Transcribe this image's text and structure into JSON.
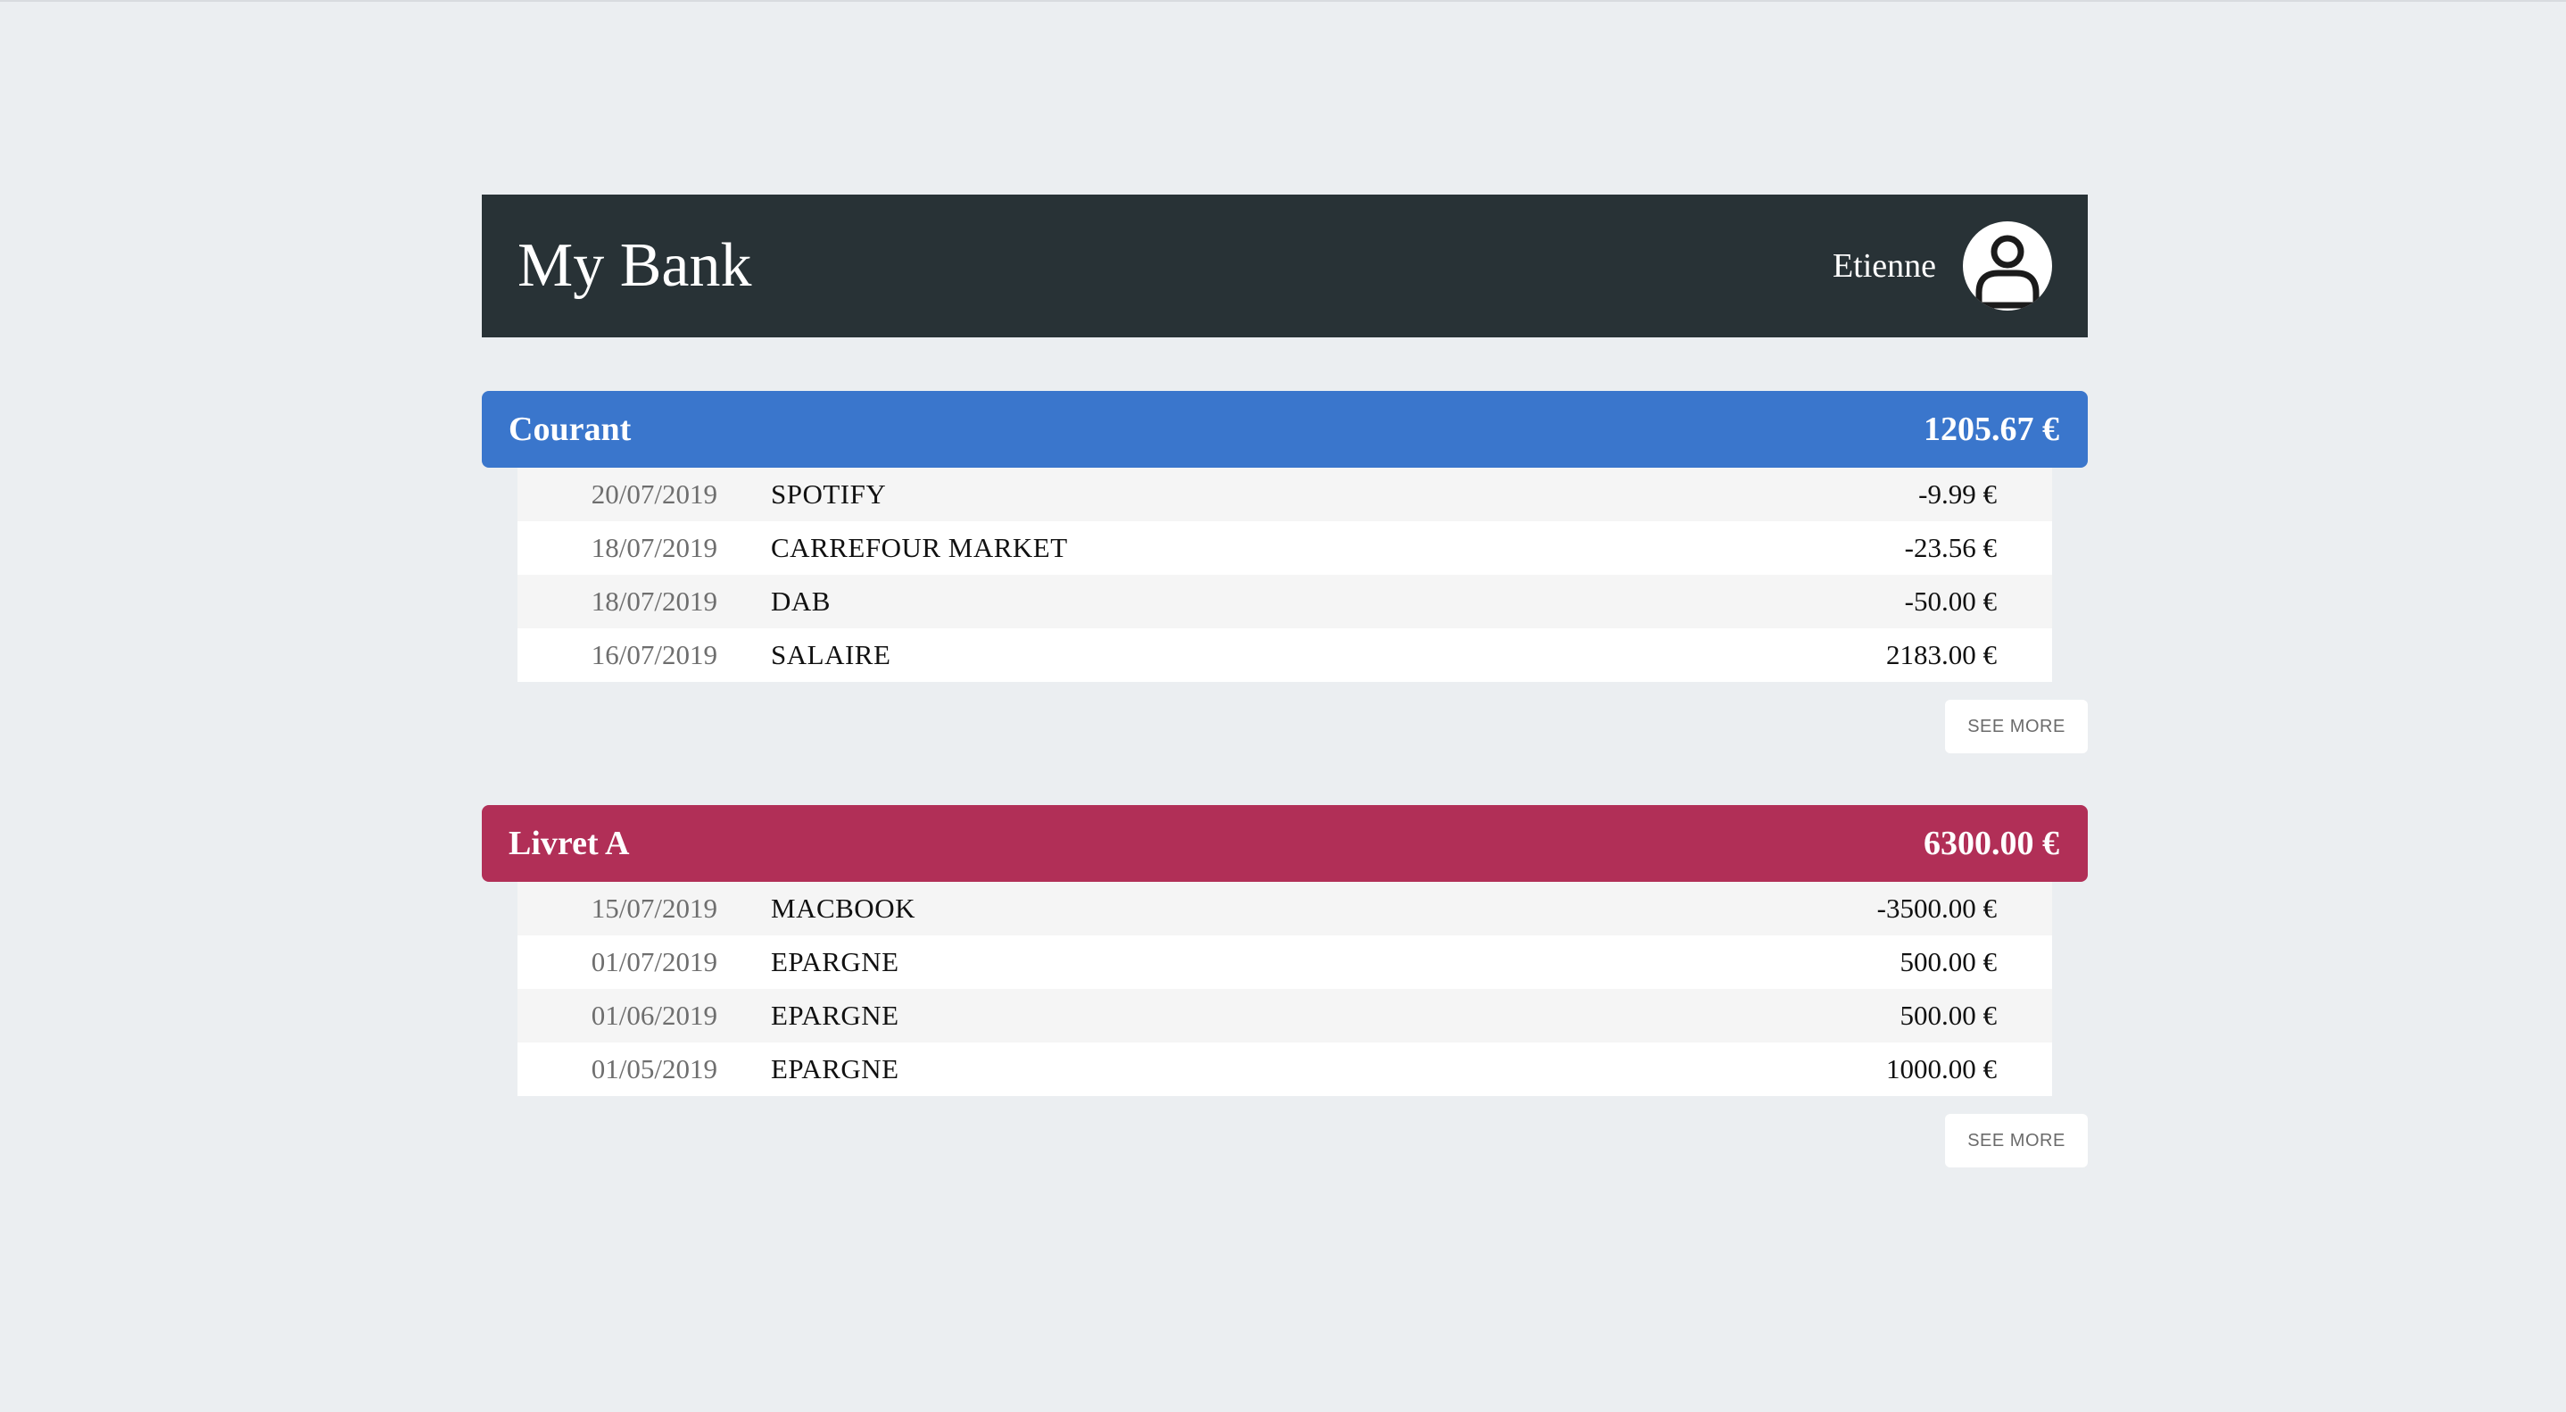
{
  "app": {
    "title": "My Bank"
  },
  "user": {
    "name": "Etienne",
    "avatar_icon": "user-avatar-icon"
  },
  "colors": {
    "header_bg": "#283236",
    "background": "#ebeef1",
    "courant_accent": "#3a76cc",
    "livret_accent": "#b12f57"
  },
  "accounts": [
    {
      "name": "Courant",
      "balance": "1205.67 €",
      "color": "#3a76cc",
      "transactions": [
        {
          "date": "20/07/2019",
          "label": "SPOTIFY",
          "amount": "-9.99 €"
        },
        {
          "date": "18/07/2019",
          "label": "CARREFOUR MARKET",
          "amount": "-23.56 €"
        },
        {
          "date": "18/07/2019",
          "label": "DAB",
          "amount": "-50.00 €"
        },
        {
          "date": "16/07/2019",
          "label": "SALAIRE",
          "amount": "2183.00 €"
        }
      ],
      "see_more_label": "SEE MORE"
    },
    {
      "name": "Livret A",
      "balance": "6300.00 €",
      "color": "#b12f57",
      "transactions": [
        {
          "date": "15/07/2019",
          "label": "MACBOOK",
          "amount": "-3500.00 €"
        },
        {
          "date": "01/07/2019",
          "label": "EPARGNE",
          "amount": "500.00 €"
        },
        {
          "date": "01/06/2019",
          "label": "EPARGNE",
          "amount": "500.00 €"
        },
        {
          "date": "01/05/2019",
          "label": "EPARGNE",
          "amount": "1000.00 €"
        }
      ],
      "see_more_label": "SEE MORE"
    }
  ]
}
